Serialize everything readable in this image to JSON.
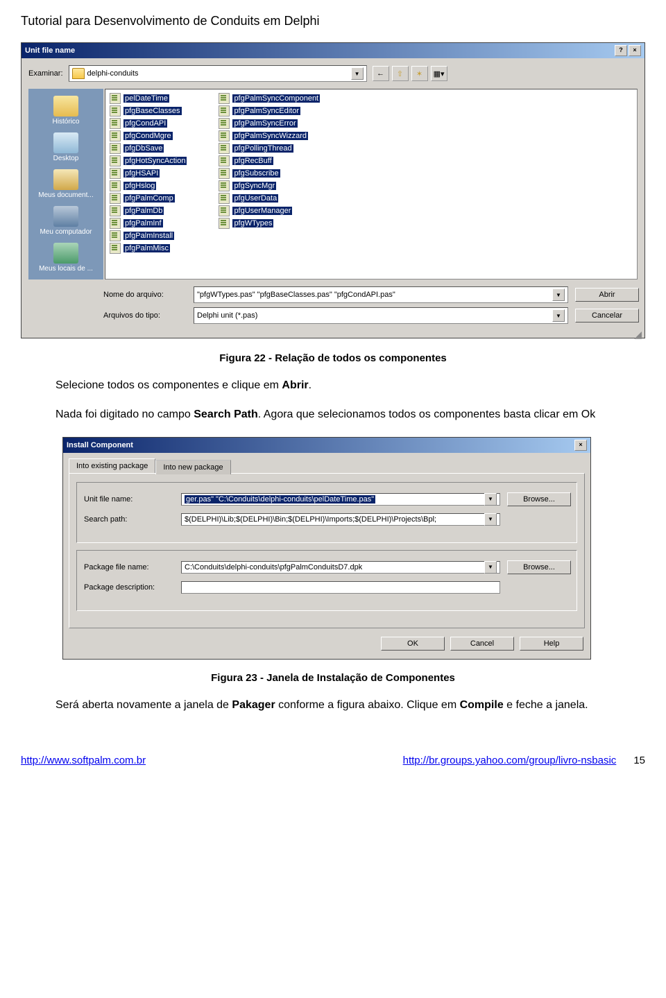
{
  "doc_title": "Tutorial para Desenvolvimento de Conduits em Delphi",
  "dialog1": {
    "title": "Unit file name",
    "examinar_label": "Examinar:",
    "folder_name": "delphi-conduits",
    "places": [
      {
        "label": "Histórico",
        "bg": "linear-gradient(#f7e6a0,#e6bb4f)"
      },
      {
        "label": "Desktop",
        "bg": "linear-gradient(#d9eaf5,#8fb8d6)"
      },
      {
        "label": "Meus document...",
        "bg": "linear-gradient(#f5e7b8,#d1a84a)"
      },
      {
        "label": "Meu computador",
        "bg": "linear-gradient(#b9c8d9,#5e7fa3)"
      },
      {
        "label": "Meus locais de ...",
        "bg": "linear-gradient(#aad5b8,#4b9a6a)"
      }
    ],
    "col1": [
      "pelDateTime",
      "pfgBaseClasses",
      "pfgCondAPI",
      "pfgCondMgre",
      "pfgDbSave",
      "pfgHotSyncAction",
      "pfgHSAPI",
      "pfgHslog",
      "pfgPalmComp",
      "pfgPalmDb",
      "pfgPalmInf",
      "pfgPalmInstall",
      "pfgPalmMisc"
    ],
    "col2": [
      "pfgPalmSyncComponent",
      "pfgPalmSyncEditor",
      "pfgPalmSyncError",
      "pfgPalmSyncWizzard",
      "pfgPollingThread",
      "pfgRecBuff",
      "pfgSubscribe",
      "pfgSyncMgr",
      "pfgUserData",
      "pfgUserManager",
      "pfgWTypes"
    ],
    "filename_label": "Nome do arquivo:",
    "filename_value": "\"pfgWTypes.pas\" \"pfgBaseClasses.pas\" \"pfgCondAPI.pas\"",
    "filetype_label": "Arquivos do tipo:",
    "filetype_value": "Delphi unit (*.pas)",
    "open_btn": "Abrir",
    "cancel_btn": "Cancelar"
  },
  "caption1": "Figura 22 - Relação de todos os componentes",
  "para1": "Selecione todos os componentes e clique em Abrir.",
  "para2": "Nada foi digitado no campo Search Path. Agora que selecionamos todos os componentes basta clicar em Ok",
  "dialog2": {
    "title": "Install Component",
    "tab1": "Into existing package",
    "tab2": "Into new package",
    "unit_label": "Unit file name:",
    "unit_value": "ger.pas\" \"C:\\Conduits\\delphi-conduits\\pelDateTime.pas\"",
    "search_label": "Search path:",
    "search_value": "$(DELPHI)\\Lib;$(DELPHI)\\Bin;$(DELPHI)\\Imports;$(DELPHI)\\Projects\\Bpl;",
    "pkgfile_label": "Package file name:",
    "pkgfile_value": "C:\\Conduits\\delphi-conduits\\pfgPalmConduitsD7.dpk",
    "pkgdesc_label": "Package description:",
    "pkgdesc_value": "",
    "browse_btn": "Browse...",
    "ok_btn": "OK",
    "cancel_btn": "Cancel",
    "help_btn": "Help"
  },
  "caption2": "Figura 23 - Janela de Instalação de Componentes",
  "para3": "Será aberta novamente a janela de Pakager conforme a figura abaixo. Clique em Compile e feche a janela.",
  "footer": {
    "link1": "http://www.softpalm.com.br",
    "link2": "http://br.groups.yahoo.com/group/livro-nsbasic",
    "page": "15"
  }
}
